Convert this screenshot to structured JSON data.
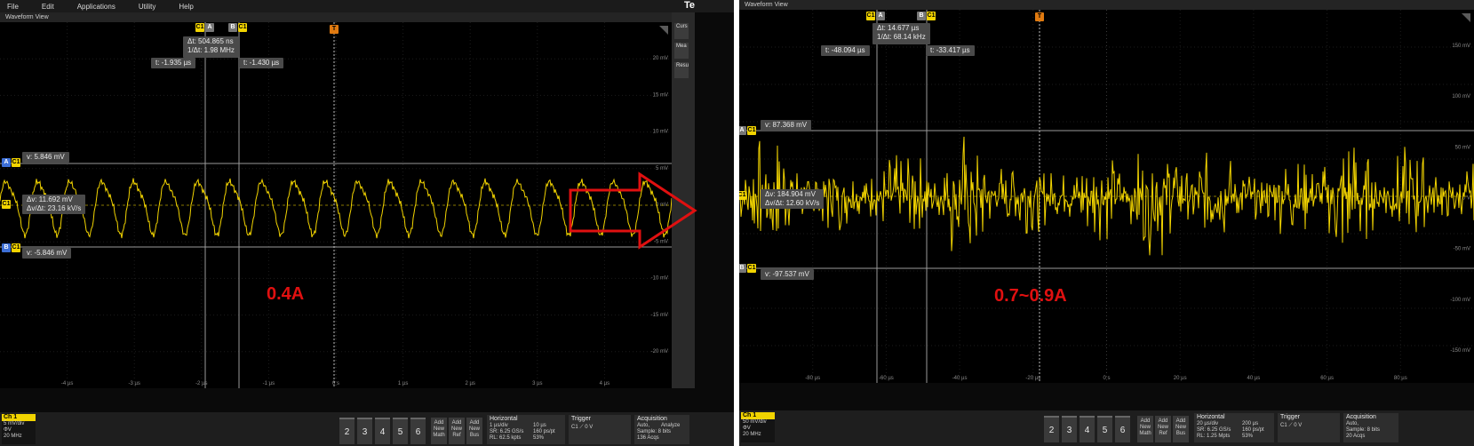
{
  "left": {
    "menu": [
      "File",
      "Edit",
      "Applications",
      "Utility",
      "Help"
    ],
    "corner_text": "Te",
    "waveform_title": "Waveform View",
    "cursor_badges": {
      "c1a": "C1",
      "a": "A",
      "b": "B",
      "c1b": "C1"
    },
    "trigger_marker": "T",
    "delta_readout": {
      "dt": "Δt: 504.865 ns",
      "inv_dt": "1/Δt: 1.98 MHz"
    },
    "t_readouts": {
      "a": "t: -1.935 µs",
      "b": "t: -1.430 µs"
    },
    "v_readouts": {
      "a": "v: 5.846 mV",
      "b": "v: -5.846 mV"
    },
    "dv_readout": {
      "dv": "Δv: 11.692 mV",
      "dvdt": "Δv/Δt: 23.16 kV/s"
    },
    "channel_label": "C1",
    "level_badges": {
      "a": "A",
      "b": "B",
      "c1a": "C1",
      "c1b": "C1"
    },
    "y_ticks": [
      "20 mV",
      "15 mV",
      "10 mV",
      "5 mV",
      "0 mV",
      "-5 mV",
      "-10 mV",
      "-15 mV",
      "-20 mV"
    ],
    "x_ticks": [
      "-4 µs",
      "-3 µs",
      "-2 µs",
      "-1 µs",
      "0 s",
      "1 µs",
      "2 µs",
      "3 µs",
      "4 µs"
    ],
    "side_items": [
      "Curs",
      "Mea",
      "Resu"
    ],
    "current_label": "0.4A",
    "bottom": {
      "ch1": {
        "label": "Ch 1",
        "lines": [
          "5 mV/div",
          "ΦV",
          "20 MHz"
        ]
      },
      "channels": [
        "2",
        "3",
        "4",
        "5",
        "6"
      ],
      "add": [
        [
          "Add",
          "New",
          "Math"
        ],
        [
          "Add",
          "New",
          "Ref"
        ],
        [
          "Add",
          "New",
          "Bus"
        ]
      ],
      "horizontal": {
        "title": "Horizontal",
        "lines": [
          "1 µs/div",
          "SR: 6.25 GS/s",
          "RL: 62.5 kpts"
        ],
        "lines2": [
          "10 µs",
          "160 ps/pt",
          "53%"
        ]
      },
      "trigger": {
        "title": "Trigger",
        "lines": [
          "C1 ⟋ 0 V"
        ]
      },
      "acquisition": {
        "title": "Acquisition",
        "lines": [
          "Auto,",
          "Sample: 8 bits",
          "136 Acqs"
        ],
        "lines2": [
          "Analyze"
        ]
      }
    }
  },
  "right": {
    "waveform_title": "Waveform View",
    "cursor_badges": {
      "c1a": "C1",
      "a": "A",
      "b": "B",
      "c1b": "C1"
    },
    "trigger_marker": "T",
    "delta_readout": {
      "dt": "Δt: 14.677 µs",
      "inv_dt": "1/Δt: 68.14 kHz"
    },
    "t_readouts": {
      "a": "t: -48.094 µs",
      "b": "t: -33.417 µs"
    },
    "v_readouts": {
      "a": "v: 87.368 mV",
      "b": "v: -97.537 mV"
    },
    "dv_readout": {
      "dv": "Δv: 184.904 mV",
      "dvdt": "Δv/Δt: 12.60 kV/s"
    },
    "channel_label": "C1",
    "level_badges": {
      "a": "A",
      "b": "B",
      "c1a": "C1",
      "c1b": "C1"
    },
    "y_ticks": [
      "150 mV",
      "100 mV",
      "50 mV",
      "0 V",
      "-50 mV",
      "-100 mV",
      "-150 mV"
    ],
    "x_ticks": [
      "-80 µs",
      "-60 µs",
      "-40 µs",
      "-20 µs",
      "0 s",
      "20 µs",
      "40 µs",
      "60 µs",
      "80 µs"
    ],
    "current_label": "0.7~0.9A",
    "bottom": {
      "ch1": {
        "label": "Ch 1",
        "lines": [
          "50 mV/div",
          "ΦV",
          "20 MHz"
        ]
      },
      "channels": [
        "2",
        "3",
        "4",
        "5",
        "6"
      ],
      "add": [
        [
          "Add",
          "New",
          "Math"
        ],
        [
          "Add",
          "New",
          "Ref"
        ],
        [
          "Add",
          "New",
          "Bus"
        ]
      ],
      "horizontal": {
        "title": "Horizontal",
        "lines": [
          "20 µs/div",
          "SR: 6.25 GS/s",
          "RL: 1.25 Mpts"
        ],
        "lines2": [
          "200 µs",
          "160 ps/pt",
          "53%"
        ]
      },
      "trigger": {
        "title": "Trigger",
        "lines": [
          "C1 ⟋ 0 V"
        ]
      },
      "acquisition": {
        "title": "Acquisition",
        "lines": [
          "Auto,",
          "Sample: 8 bits",
          "20 Acqs"
        ]
      }
    }
  },
  "colors": {
    "trace": "#f2d400",
    "cursor_a": "#3d6fd6",
    "arrow": "#e01010",
    "label": "#e01010"
  }
}
